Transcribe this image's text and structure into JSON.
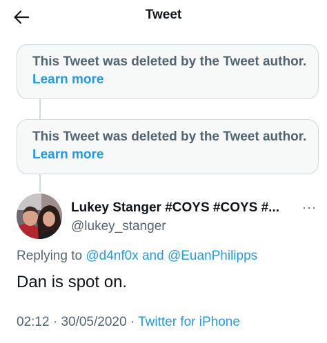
{
  "header": {
    "title": "Tweet",
    "back_icon": "arrow-left-icon"
  },
  "deleted_cards": [
    {
      "text": "This Tweet was deleted by the Tweet author.",
      "link": "Learn more"
    },
    {
      "text": "This Tweet was deleted by the Tweet author.",
      "link": "Learn more"
    }
  ],
  "tweet": {
    "display_name": "Lukey Stanger #COYS #COYS #...",
    "handle": "@lukey_stanger",
    "more_icon": "more-horizontal-icon",
    "replying_prefix": "Replying to",
    "mention_1": "@d4nf0x",
    "replying_and": "and",
    "mention_2": "@EuanPhilipps",
    "text": "Dan is spot on.",
    "time": "02:12",
    "separator": "·",
    "date": "30/05/2020",
    "source": "Twitter for iPhone"
  },
  "colors": {
    "accent": "#1d9bf0",
    "secondary_text": "#536471",
    "border": "#cfd9de",
    "card_bg": "#f7f9f9"
  }
}
